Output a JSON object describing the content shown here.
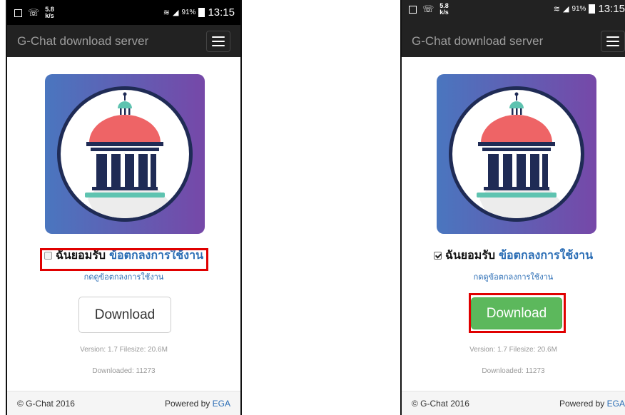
{
  "status_bar": {
    "network_speed": "5.8",
    "network_unit": "k/s",
    "battery": "91%",
    "time": "13:15"
  },
  "navbar": {
    "brand": "G-Chat download server",
    "menu_icon": "hamburger-menu-icon"
  },
  "logo": {
    "icon": "government-building-icon",
    "colors": {
      "bg_start": "#4a76bf",
      "bg_end": "#7648a8",
      "dome": "#ee6466",
      "pillar": "#1f2b55",
      "base": "#5ec3b0",
      "shadow": "#dcdcdc"
    }
  },
  "terms": {
    "accept_text": "ฉันยอมรับ",
    "link_text": "ข้อตกลงการใช้งาน",
    "sub_link": "กดดูข้อตกลงการใช้งาน"
  },
  "download": {
    "label": "Download",
    "version_text": "Version: 1.7  Filesize: 20.6M",
    "downloaded_text": "Downloaded: 11273"
  },
  "footer": {
    "copyright": "© G-Chat 2016",
    "powered_by": "Powered by",
    "powered_by_brand": "EGA"
  },
  "states": [
    {
      "terms_checked": false,
      "download_enabled": false
    },
    {
      "terms_checked": true,
      "download_enabled": true
    }
  ],
  "colors": {
    "navbar_bg": "#222222",
    "highlight": "#e00000",
    "link": "#2a6db5",
    "download_active": "#5cb85c"
  }
}
